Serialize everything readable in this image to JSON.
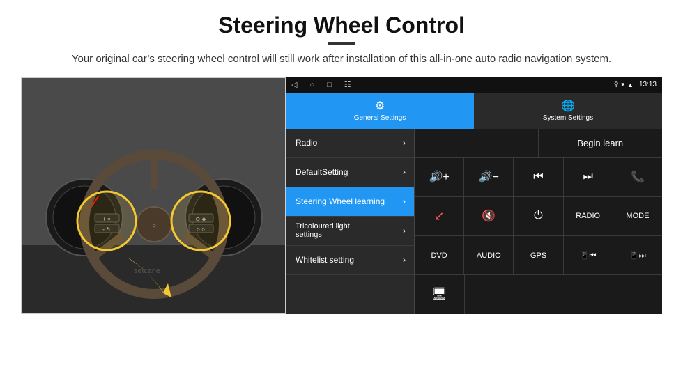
{
  "page": {
    "title": "Steering Wheel Control",
    "subtitle": "Your original car’s steering wheel control will still work after installation of this all-in-one auto radio navigation system."
  },
  "android": {
    "status_bar": {
      "time": "13:13",
      "icons": [
        "location",
        "wifi",
        "signal"
      ]
    },
    "tabs": [
      {
        "id": "general",
        "label": "General Settings",
        "icon": "⚙",
        "active": true
      },
      {
        "id": "system",
        "label": "System Settings",
        "icon": "🌐",
        "active": false
      }
    ],
    "nav_bar": {
      "back": "◁",
      "home": "○",
      "recent": "□",
      "cast": "☷"
    },
    "menu_items": [
      {
        "id": "radio",
        "label": "Radio",
        "active": false
      },
      {
        "id": "default",
        "label": "DefaultSetting",
        "active": false
      },
      {
        "id": "steering",
        "label": "Steering Wheel learning",
        "active": true
      },
      {
        "id": "tricoloured",
        "label": "Tricoloured light settings",
        "active": false
      },
      {
        "id": "whitelist",
        "label": "Whitelist setting",
        "active": false
      }
    ],
    "begin_learn_label": "Begin learn",
    "control_buttons": [
      [
        {
          "id": "vol-up",
          "label": "🔊+",
          "type": "icon"
        },
        {
          "id": "vol-down",
          "label": "🔊−",
          "type": "icon"
        },
        {
          "id": "prev",
          "label": "⏮",
          "type": "icon"
        },
        {
          "id": "next",
          "label": "⏭",
          "type": "icon"
        },
        {
          "id": "call",
          "label": "📞",
          "type": "icon"
        }
      ],
      [
        {
          "id": "hang-up",
          "label": "⬏",
          "type": "icon"
        },
        {
          "id": "mute",
          "label": "🔇",
          "type": "icon"
        },
        {
          "id": "power",
          "label": "⏻",
          "type": "icon"
        },
        {
          "id": "radio-btn",
          "label": "RADIO",
          "type": "text"
        },
        {
          "id": "mode-btn",
          "label": "MODE",
          "type": "text"
        }
      ],
      [
        {
          "id": "dvd",
          "label": "DVD",
          "type": "text"
        },
        {
          "id": "audio",
          "label": "AUDIO",
          "type": "text"
        },
        {
          "id": "gps",
          "label": "GPS",
          "type": "text"
        },
        {
          "id": "tel-prev",
          "label": "📱⏮",
          "type": "icon"
        },
        {
          "id": "tel-next",
          "label": "📱⏭",
          "type": "icon"
        }
      ],
      [
        {
          "id": "list",
          "label": "☰",
          "type": "icon"
        }
      ]
    ]
  }
}
